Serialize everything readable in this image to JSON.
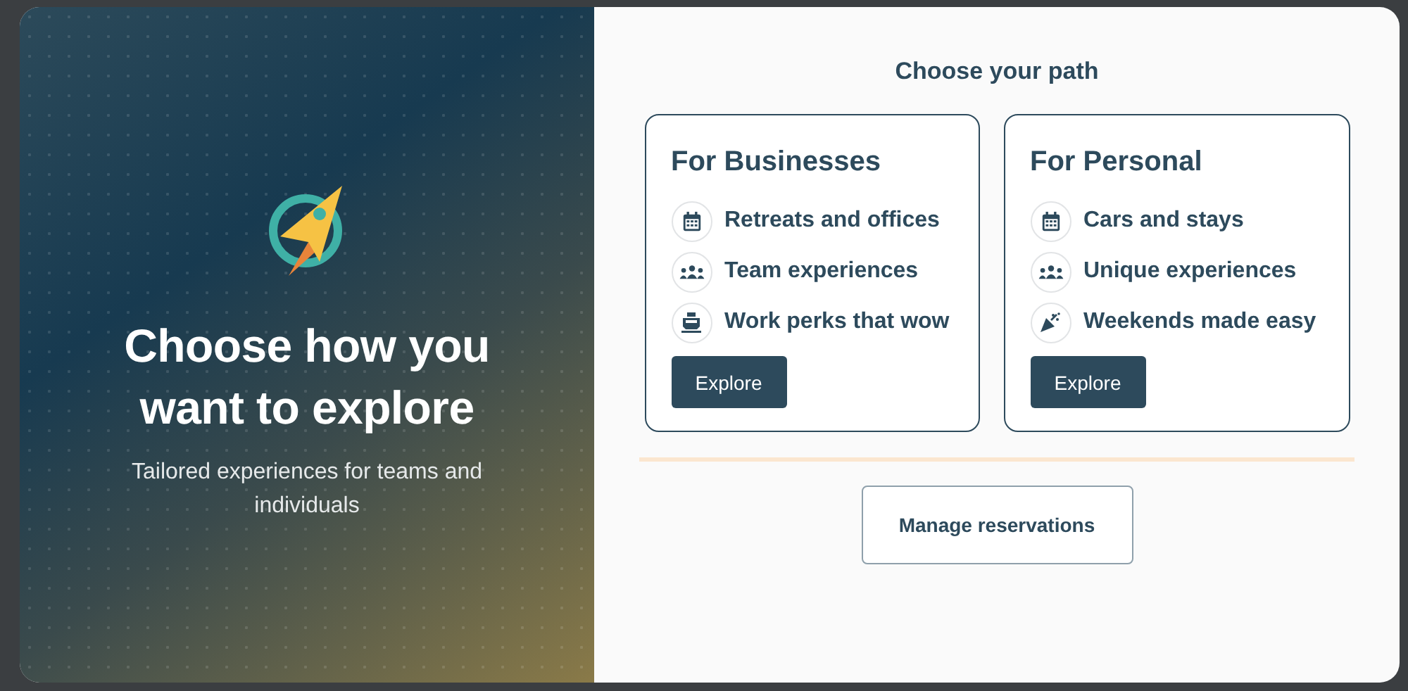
{
  "hero": {
    "heading": "Choose how you want to explore",
    "subtitle": "Tailored experiences for teams and individuals"
  },
  "panel": {
    "title": "Choose your path",
    "cards": [
      {
        "title": "For Businesses",
        "items": [
          {
            "kind": "calendar",
            "label": "Retreats and offices"
          },
          {
            "kind": "people",
            "label": "Team experiences"
          },
          {
            "kind": "ship",
            "label": "Work perks that wow"
          }
        ],
        "button": "Explore"
      },
      {
        "title": "For Personal",
        "items": [
          {
            "kind": "calendar",
            "label": "Cars and stays"
          },
          {
            "kind": "people",
            "label": "Unique experiences"
          },
          {
            "kind": "party",
            "label": "Weekends made easy"
          }
        ],
        "button": "Explore"
      }
    ],
    "secondary_button": "Manage reservations"
  }
}
